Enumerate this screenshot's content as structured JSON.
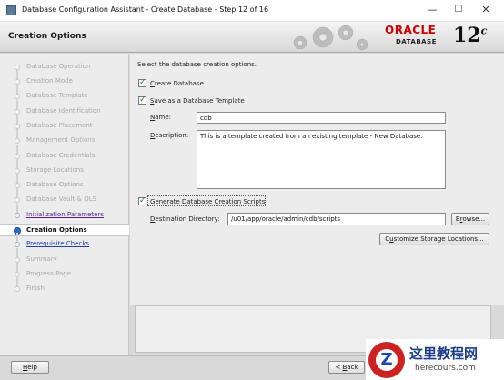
{
  "window": {
    "title": "Database Configuration Assistant - Create Database - Step 12 of 16",
    "minimize_glyph": "—",
    "maximize_glyph": "☐",
    "close_glyph": "✕"
  },
  "header": {
    "page_title": "Creation Options",
    "brand": "ORACLE",
    "brand_sub": "DATABASE",
    "version": "12",
    "version_suffix": "c"
  },
  "steps": [
    {
      "label": "Database Operation",
      "state": "disabled"
    },
    {
      "label": "Creation Mode",
      "state": "disabled"
    },
    {
      "label": "Database Template",
      "state": "disabled"
    },
    {
      "label": "Database Identification",
      "state": "disabled"
    },
    {
      "label": "Database Placement",
      "state": "disabled"
    },
    {
      "label": "Management Options",
      "state": "disabled"
    },
    {
      "label": "Database Credentials",
      "state": "disabled"
    },
    {
      "label": "Storage Locations",
      "state": "disabled"
    },
    {
      "label": "Database Options",
      "state": "disabled"
    },
    {
      "label": "Database Vault & OLS",
      "state": "disabled"
    },
    {
      "label": "Initialization Parameters",
      "state": "visited"
    },
    {
      "label": "Creation Options",
      "state": "current"
    },
    {
      "label": "Prerequisite Checks",
      "state": "next"
    },
    {
      "label": "Summary",
      "state": "disabled"
    },
    {
      "label": "Progress Page",
      "state": "disabled"
    },
    {
      "label": "Finish",
      "state": "disabled"
    }
  ],
  "main": {
    "instruction": "Select the database creation options.",
    "create_db": {
      "label_u": "C",
      "label_rest": "reate Database",
      "checked": true
    },
    "save_template": {
      "label_u": "S",
      "label_rest": "ave as a Database Template",
      "checked": true
    },
    "name_label_u": "N",
    "name_label_rest": "ame:",
    "name_value": "cdb",
    "desc_label_u": "D",
    "desc_label_rest": "escription:",
    "desc_value": "This is a template created from an existing template - New Database.",
    "gen_scripts": {
      "label_u": "G",
      "label_rest": "enerate Database Creation Scripts",
      "checked": true
    },
    "dest_label_u": "D",
    "dest_label_rest": "estination Directory:",
    "dest_value": "/u01/app/oracle/admin/cdb/scripts",
    "browse_label_pre": "B",
    "browse_label_u": "r",
    "browse_label_rest": "owse...",
    "customize_label_pre": "C",
    "customize_label_u": "u",
    "customize_label_rest": "stomize Storage Locations..."
  },
  "footer": {
    "help_label_u": "H",
    "help_label_rest": "elp",
    "back_label_pre": "< ",
    "back_label_u": "B",
    "back_label_rest": "ack",
    "back_icon": "chevron-left-icon"
  },
  "watermark": {
    "logo_letter": "Z",
    "text_cn": "这里教程网",
    "text_url": "herecours.com"
  },
  "colors": {
    "oracle_red": "#d00000",
    "current_step": "#2a6ad0",
    "link_visited": "#5a1f8f",
    "link_next": "#1a3fa8",
    "check_green": "#1c7a2a"
  }
}
